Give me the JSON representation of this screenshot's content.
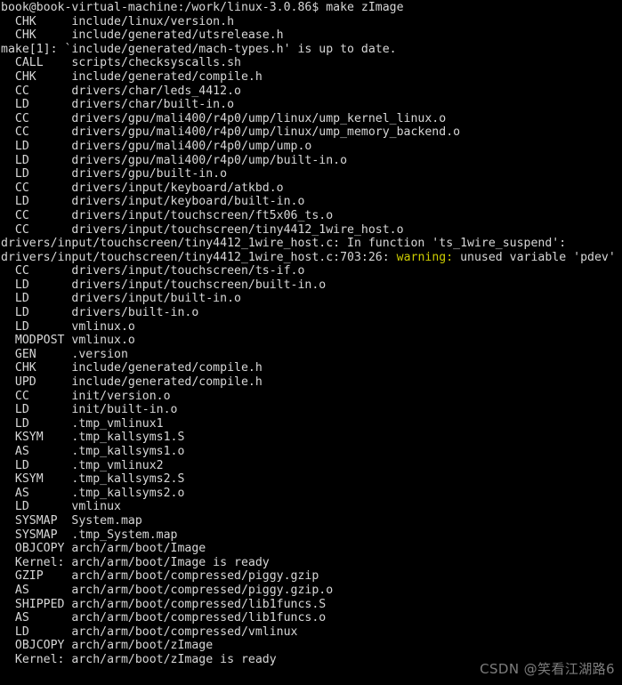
{
  "terminal": {
    "title": "book@book-virtual-machine: /work/linux-3.0.86",
    "background_color": "#000000",
    "foreground_color": "#d7d7d7",
    "warning_color": "#cdcd00",
    "prompt": "book@book-virtual-machine:/work/linux-3.0.86$ ",
    "command": "make zImage",
    "lines": [
      {
        "segments": [
          {
            "text": "book@book-virtual-machine:/work/linux-3.0.86$ make zImage",
            "color": "default"
          }
        ]
      },
      {
        "segments": [
          {
            "text": "  CHK     include/linux/version.h",
            "color": "default"
          }
        ]
      },
      {
        "segments": [
          {
            "text": "  CHK     include/generated/utsrelease.h",
            "color": "default"
          }
        ]
      },
      {
        "segments": [
          {
            "text": "make[1]: `include/generated/mach-types.h' is up to date.",
            "color": "default"
          }
        ]
      },
      {
        "segments": [
          {
            "text": "  CALL    scripts/checksyscalls.sh",
            "color": "default"
          }
        ]
      },
      {
        "segments": [
          {
            "text": "  CHK     include/generated/compile.h",
            "color": "default"
          }
        ]
      },
      {
        "segments": [
          {
            "text": "  CC      drivers/char/leds_4412.o",
            "color": "default"
          }
        ]
      },
      {
        "segments": [
          {
            "text": "  LD      drivers/char/built-in.o",
            "color": "default"
          }
        ]
      },
      {
        "segments": [
          {
            "text": "  CC      drivers/gpu/mali400/r4p0/ump/linux/ump_kernel_linux.o",
            "color": "default"
          }
        ]
      },
      {
        "segments": [
          {
            "text": "  CC      drivers/gpu/mali400/r4p0/ump/linux/ump_memory_backend.o",
            "color": "default"
          }
        ]
      },
      {
        "segments": [
          {
            "text": "  LD      drivers/gpu/mali400/r4p0/ump/ump.o",
            "color": "default"
          }
        ]
      },
      {
        "segments": [
          {
            "text": "  LD      drivers/gpu/mali400/r4p0/ump/built-in.o",
            "color": "default"
          }
        ]
      },
      {
        "segments": [
          {
            "text": "  LD      drivers/gpu/built-in.o",
            "color": "default"
          }
        ]
      },
      {
        "segments": [
          {
            "text": "  CC      drivers/input/keyboard/atkbd.o",
            "color": "default"
          }
        ]
      },
      {
        "segments": [
          {
            "text": "  LD      drivers/input/keyboard/built-in.o",
            "color": "default"
          }
        ]
      },
      {
        "segments": [
          {
            "text": "  CC      drivers/input/touchscreen/ft5x06_ts.o",
            "color": "default"
          }
        ]
      },
      {
        "segments": [
          {
            "text": "  CC      drivers/input/touchscreen/tiny4412_1wire_host.o",
            "color": "default"
          }
        ]
      },
      {
        "segments": [
          {
            "text": "drivers/input/touchscreen/tiny4412_1wire_host.c: In function 'ts_1wire_suspend':",
            "color": "default"
          }
        ]
      },
      {
        "segments": [
          {
            "text": "drivers/input/touchscreen/tiny4412_1wire_host.c:703:26: ",
            "color": "default"
          },
          {
            "text": "warning:",
            "color": "warning"
          },
          {
            "text": " unused variable 'pdev'",
            "color": "default"
          }
        ]
      },
      {
        "segments": [
          {
            "text": "  CC      drivers/input/touchscreen/ts-if.o",
            "color": "default"
          }
        ]
      },
      {
        "segments": [
          {
            "text": "  LD      drivers/input/touchscreen/built-in.o",
            "color": "default"
          }
        ]
      },
      {
        "segments": [
          {
            "text": "  LD      drivers/input/built-in.o",
            "color": "default"
          }
        ]
      },
      {
        "segments": [
          {
            "text": "  LD      drivers/built-in.o",
            "color": "default"
          }
        ]
      },
      {
        "segments": [
          {
            "text": "  LD      vmlinux.o",
            "color": "default"
          }
        ]
      },
      {
        "segments": [
          {
            "text": "  MODPOST vmlinux.o",
            "color": "default"
          }
        ]
      },
      {
        "segments": [
          {
            "text": "  GEN     .version",
            "color": "default"
          }
        ]
      },
      {
        "segments": [
          {
            "text": "  CHK     include/generated/compile.h",
            "color": "default"
          }
        ]
      },
      {
        "segments": [
          {
            "text": "  UPD     include/generated/compile.h",
            "color": "default"
          }
        ]
      },
      {
        "segments": [
          {
            "text": "  CC      init/version.o",
            "color": "default"
          }
        ]
      },
      {
        "segments": [
          {
            "text": "  LD      init/built-in.o",
            "color": "default"
          }
        ]
      },
      {
        "segments": [
          {
            "text": "  LD      .tmp_vmlinux1",
            "color": "default"
          }
        ]
      },
      {
        "segments": [
          {
            "text": "  KSYM    .tmp_kallsyms1.S",
            "color": "default"
          }
        ]
      },
      {
        "segments": [
          {
            "text": "  AS      .tmp_kallsyms1.o",
            "color": "default"
          }
        ]
      },
      {
        "segments": [
          {
            "text": "  LD      .tmp_vmlinux2",
            "color": "default"
          }
        ]
      },
      {
        "segments": [
          {
            "text": "  KSYM    .tmp_kallsyms2.S",
            "color": "default"
          }
        ]
      },
      {
        "segments": [
          {
            "text": "  AS      .tmp_kallsyms2.o",
            "color": "default"
          }
        ]
      },
      {
        "segments": [
          {
            "text": "  LD      vmlinux",
            "color": "default"
          }
        ]
      },
      {
        "segments": [
          {
            "text": "  SYSMAP  System.map",
            "color": "default"
          }
        ]
      },
      {
        "segments": [
          {
            "text": "  SYSMAP  .tmp_System.map",
            "color": "default"
          }
        ]
      },
      {
        "segments": [
          {
            "text": "  OBJCOPY arch/arm/boot/Image",
            "color": "default"
          }
        ]
      },
      {
        "segments": [
          {
            "text": "  Kernel: arch/arm/boot/Image is ready",
            "color": "default"
          }
        ]
      },
      {
        "segments": [
          {
            "text": "  GZIP    arch/arm/boot/compressed/piggy.gzip",
            "color": "default"
          }
        ]
      },
      {
        "segments": [
          {
            "text": "  AS      arch/arm/boot/compressed/piggy.gzip.o",
            "color": "default"
          }
        ]
      },
      {
        "segments": [
          {
            "text": "  SHIPPED arch/arm/boot/compressed/lib1funcs.S",
            "color": "default"
          }
        ]
      },
      {
        "segments": [
          {
            "text": "  AS      arch/arm/boot/compressed/lib1funcs.o",
            "color": "default"
          }
        ]
      },
      {
        "segments": [
          {
            "text": "  LD      arch/arm/boot/compressed/vmlinux",
            "color": "default"
          }
        ]
      },
      {
        "segments": [
          {
            "text": "  OBJCOPY arch/arm/boot/zImage",
            "color": "default"
          }
        ]
      },
      {
        "segments": [
          {
            "text": "  Kernel: arch/arm/boot/zImage is ready",
            "color": "default"
          }
        ]
      }
    ]
  },
  "watermark": {
    "text": "CSDN @笑看江湖路6",
    "color": "#7d7d7d"
  }
}
